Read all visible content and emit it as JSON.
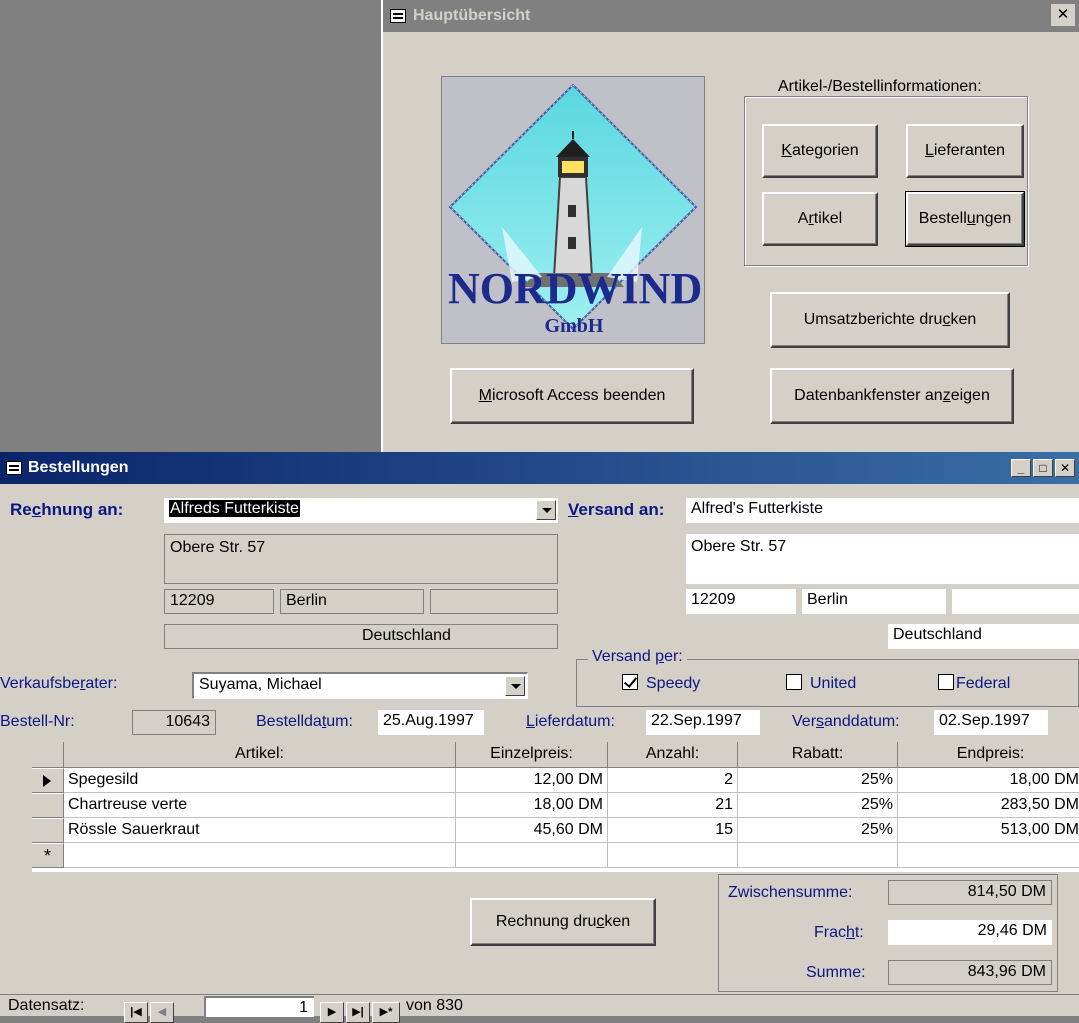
{
  "main_window": {
    "title": "Hauptübersicht",
    "group_label": "Artikel-/Bestellinformationen:",
    "logo": {
      "name": "NORDWIND",
      "sub": "GmbH"
    },
    "buttons": {
      "kategorien": "Kategorien",
      "lieferanten": "Lieferanten",
      "artikel": "Artikel",
      "bestellungen": "Bestellungen",
      "umsatz": "Umsatzberichte drucken",
      "access_beenden": "Microsoft Access beenden",
      "db_fenster": "Datenbankfenster anzeigen"
    }
  },
  "order_window": {
    "title": "Bestellungen",
    "rechnung_label": "Rechnung an:",
    "rechnung": {
      "name": "Alfreds Futterkiste",
      "street": "Obere Str. 57",
      "zip": "12209",
      "city": "Berlin",
      "region": "",
      "country": "Deutschland"
    },
    "versand_label": "Versand an:",
    "versand": {
      "name": "Alfred's Futterkiste",
      "street": "Obere Str. 57",
      "zip": "12209",
      "city": "Berlin",
      "region": "",
      "country": "Deutschland"
    },
    "berater_label": "Verkaufsberater:",
    "berater_value": "Suyama, Michael",
    "versand_per_label": "Versand per:",
    "shippers": [
      {
        "label": "Speedy",
        "checked": true
      },
      {
        "label": "United",
        "checked": false
      },
      {
        "label": "Federal",
        "checked": false
      }
    ],
    "bestell_nr_label": "Bestell-Nr:",
    "bestell_nr": "10643",
    "bestelldatum_label": "Bestelldatum:",
    "bestelldatum": "25.Aug.1997",
    "lieferdatum_label": "Lieferdatum:",
    "lieferdatum": "22.Sep.1997",
    "versanddatum_label": "Versanddatum:",
    "versanddatum": "02.Sep.1997",
    "grid": {
      "headers": [
        "Artikel:",
        "Einzelpreis:",
        "Anzahl:",
        "Rabatt:",
        "Endpreis:"
      ],
      "rows": [
        [
          "Spegesild",
          "12,00 DM",
          "2",
          "25%",
          "18,00 DM"
        ],
        [
          "Chartreuse verte",
          "18,00 DM",
          "21",
          "25%",
          "283,50 DM"
        ],
        [
          "Rössle Sauerkraut",
          "45,60 DM",
          "15",
          "25%",
          "513,00 DM"
        ]
      ],
      "new_row_marker": "*"
    },
    "print_button": "Rechnung drucken",
    "totals": {
      "zwischensumme_label": "Zwischensumme:",
      "zwischensumme": "814,50 DM",
      "fracht_label": "Fracht:",
      "fracht": "29,46 DM",
      "summe_label": "Summe:",
      "summe": "843,96 DM"
    },
    "nav": {
      "label": "Datensatz:",
      "current": "1",
      "of_text": "von 830"
    }
  }
}
